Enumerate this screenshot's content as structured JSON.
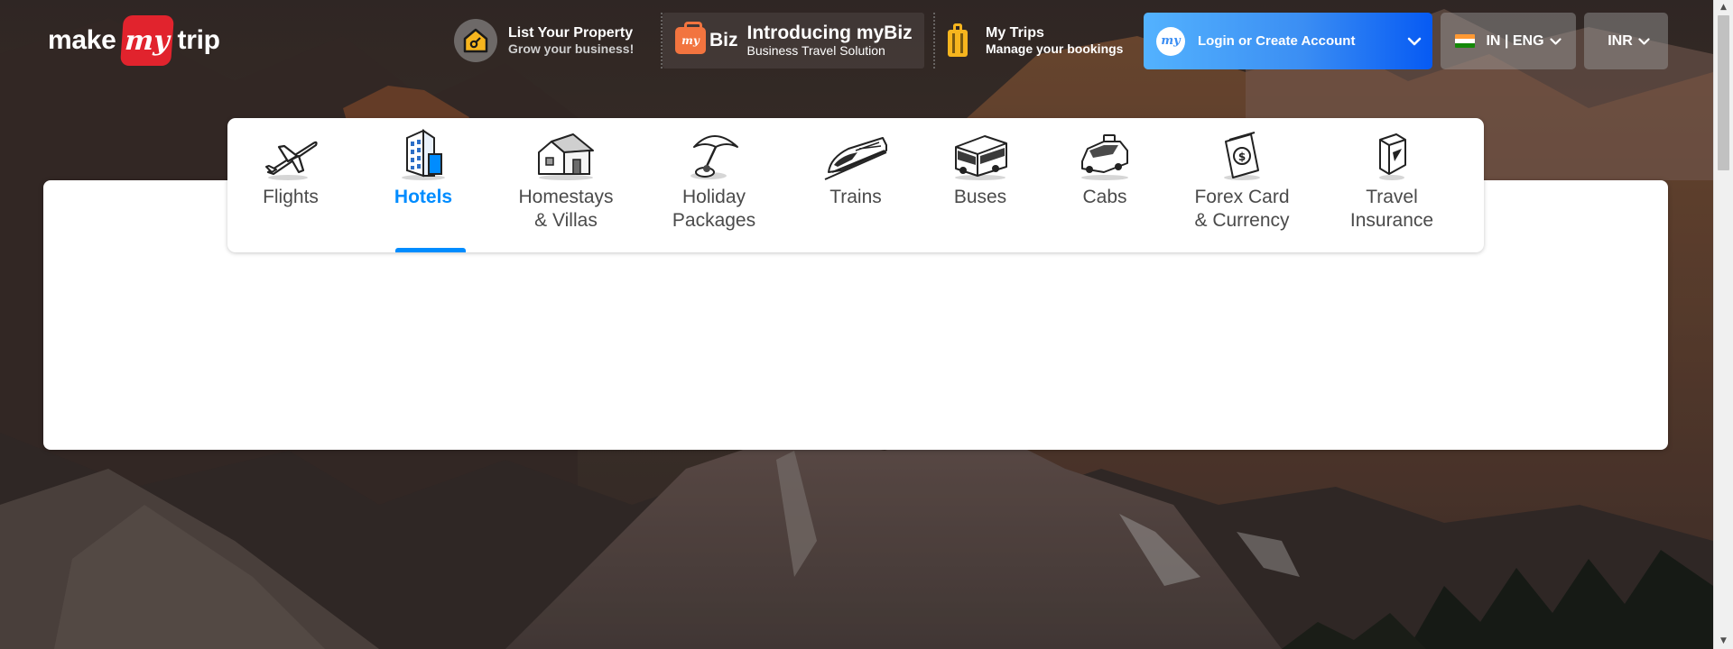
{
  "brand": {
    "logo_part1": "make",
    "logo_mark": "my",
    "logo_part2": "trip"
  },
  "header": {
    "list_property": {
      "title": "List Your Property",
      "subtitle": "Grow your business!",
      "icon": "house-key-icon"
    },
    "mybiz": {
      "badge_text": "Biz",
      "title": "Introducing myBiz",
      "subtitle": "Business Travel Solution",
      "icon": "briefcase-icon"
    },
    "my_trips": {
      "title": "My Trips",
      "subtitle": "Manage your bookings",
      "icon": "suitcase-icon"
    },
    "login": {
      "label": "Login or Create Account",
      "avatar_text": "my"
    },
    "language": {
      "label": "IN | ENG",
      "icon": "india-flag-icon"
    },
    "currency": {
      "label": "INR"
    }
  },
  "tabs": [
    {
      "label_line1": "Flights",
      "label_line2": "",
      "icon": "plane-icon",
      "active": false
    },
    {
      "label_line1": "Hotels",
      "label_line2": "",
      "icon": "hotel-building-icon",
      "active": true
    },
    {
      "label_line1": "Homestays",
      "label_line2": "& Villas",
      "icon": "homestay-icon",
      "active": false
    },
    {
      "label_line1": "Holiday",
      "label_line2": "Packages",
      "icon": "beach-umbrella-icon",
      "active": false
    },
    {
      "label_line1": "Trains",
      "label_line2": "",
      "icon": "train-icon",
      "active": false
    },
    {
      "label_line1": "Buses",
      "label_line2": "",
      "icon": "bus-icon",
      "active": false
    },
    {
      "label_line1": "Cabs",
      "label_line2": "",
      "icon": "cab-icon",
      "active": false
    },
    {
      "label_line1": "Forex Card",
      "label_line2": "& Currency",
      "icon": "forex-card-icon",
      "active": false
    },
    {
      "label_line1": "Travel",
      "label_line2": "Insurance",
      "icon": "insurance-shield-icon",
      "active": false
    }
  ],
  "colors": {
    "accent": "#008cff",
    "brand_red": "#e1232d",
    "login_gradient_start": "#53b2fe",
    "login_gradient_end": "#065af3",
    "tab_text": "#4a4a4a"
  }
}
